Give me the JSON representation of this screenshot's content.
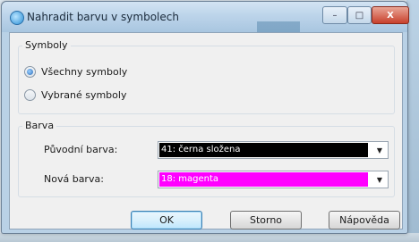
{
  "window": {
    "title": "Nahradit barvu v symbolech",
    "controls": {
      "minimize": "–",
      "maximize": "□",
      "close": "X"
    }
  },
  "symbols_group": {
    "legend": "Symboly",
    "options": [
      {
        "label": "Všechny symboly",
        "selected": true
      },
      {
        "label": "Vybrané symboly",
        "selected": false
      }
    ]
  },
  "color_group": {
    "legend": "Barva",
    "original": {
      "label": "Původní barva:",
      "value": "41: černa složena",
      "swatch_color": "#000000"
    },
    "new": {
      "label": "Nová barva:",
      "value": "18: magenta",
      "swatch_color": "#ff00ff"
    }
  },
  "buttons": {
    "ok": "OK",
    "cancel": "Storno",
    "help": "Nápověda"
  },
  "icons": {
    "title": "app-icon",
    "dropdown": "chevron-down-icon"
  }
}
